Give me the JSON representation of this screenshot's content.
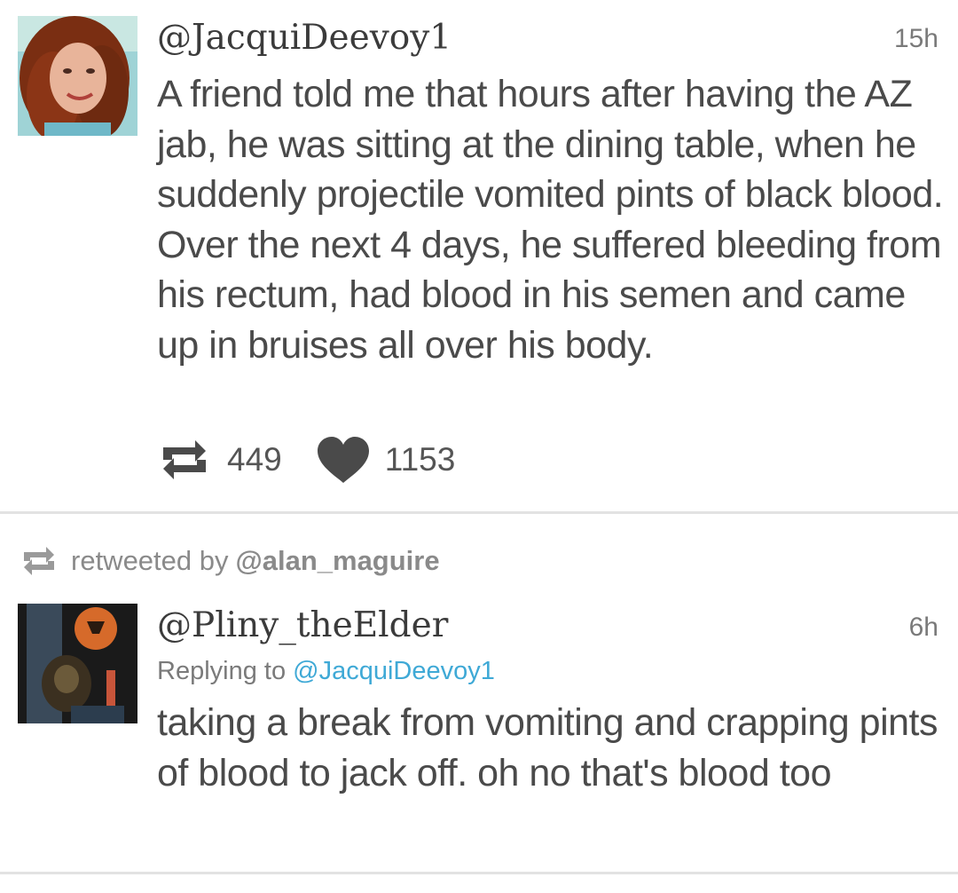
{
  "tweets": [
    {
      "handle": "@JacquiDeevoy1",
      "time": "15h",
      "text": "A friend told me that hours after having the AZ jab, he was sitting at the dining table, when he suddenly projectile vomited pints of black blood. Over the next 4 days, he suffered bleeding from his rectum, had blood in his semen and came up in bruises all over his body.",
      "retweets": "449",
      "likes": "1153",
      "avatar_icon": "profile-photo-woman"
    },
    {
      "retweeted_by_label": "retweeted by",
      "retweeted_by_handle": "@alan_maguire",
      "handle": "@Pliny_theElder",
      "time": "6h",
      "replying_to_label": "Replying to",
      "replying_to_handle": "@JacquiDeevoy1",
      "text": "taking a break from vomiting and crapping pints of blood to jack off. oh no that's blood too",
      "avatar_icon": "profile-photo-dark-art"
    }
  ],
  "colors": {
    "link": "#3fa9d6",
    "text": "#4a4a4a",
    "muted": "#8a8a8a",
    "divider": "#e2e2e2"
  }
}
